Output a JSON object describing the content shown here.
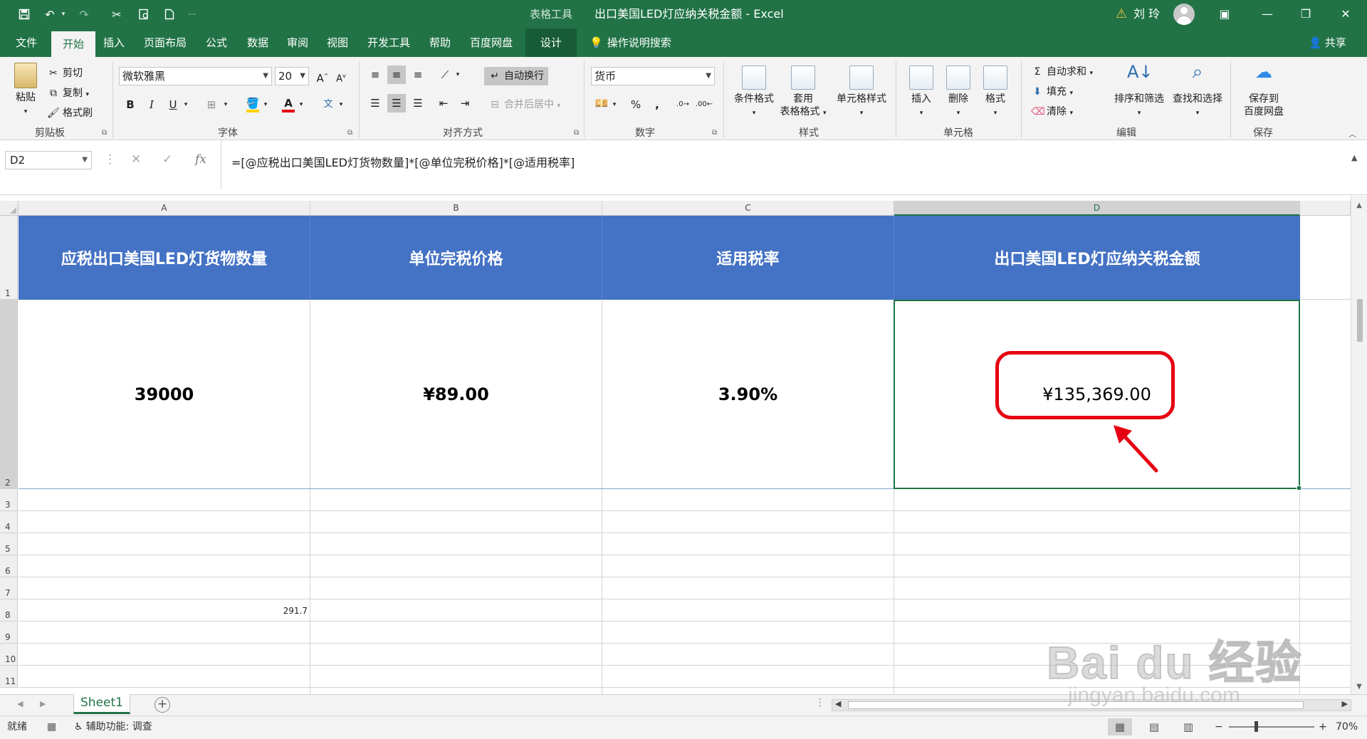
{
  "titlebar": {
    "context_tools": "表格工具",
    "doc_title": "出口美国LED灯应纳关税金额  -  Excel",
    "user": "刘 玲",
    "save_icon": "save-icon",
    "undo_icon": "undo-icon",
    "redo_icon": "redo-icon",
    "cut_icon": "cut-icon",
    "preview_icon": "print-preview-icon",
    "new_icon": "new-document-icon",
    "customize": "customize-quick-access-icon",
    "warning_icon": "warning-icon",
    "min": "—",
    "max": "❐",
    "close": "✕",
    "ribbon_display": "▣"
  },
  "tabs": [
    "文件",
    "开始",
    "插入",
    "页面布局",
    "公式",
    "数据",
    "审阅",
    "视图",
    "开发工具",
    "帮助",
    "百度网盘",
    "设计"
  ],
  "tell_me": "操作说明搜索",
  "share": "共享",
  "ribbon": {
    "clipboard": {
      "paste": "粘贴",
      "cut": "剪切",
      "copy": "复制",
      "format_painter": "格式刷",
      "label": "剪贴板"
    },
    "font": {
      "name": "微软雅黑",
      "size": "20",
      "grow": "A",
      "shrink": "A",
      "bold": "B",
      "italic": "I",
      "underline": "U",
      "phonetic": "文",
      "label": "字体",
      "font_color": "#e60012",
      "fill_color": "#ffd400"
    },
    "alignment": {
      "wrap": "自动换行",
      "merge": "合并后居中",
      "label": "对齐方式"
    },
    "number": {
      "format": "货币",
      "percent": "%",
      "comma": ",",
      "label": "数字"
    },
    "styles": {
      "conditional": "条件格式",
      "as_table_1": "套用",
      "as_table_2": "表格格式",
      "cell_styles": "单元格样式",
      "label": "样式"
    },
    "cells": {
      "insert": "插入",
      "delete": "删除",
      "format": "格式",
      "label": "单元格"
    },
    "editing": {
      "autosum": "自动求和",
      "fill": "填充",
      "clear": "清除",
      "sort": "排序和筛选",
      "find": "查找和选择",
      "label": "编辑"
    },
    "save": {
      "line1": "保存到",
      "line2": "百度网盘",
      "label": "保存"
    }
  },
  "formula_bar": {
    "name_box": "D2",
    "formula": "=[@应税出口美国LED灯货物数量]*[@单位完税价格]*[@适用税率]",
    "fx": "fx"
  },
  "columns": [
    "A",
    "B",
    "C",
    "D"
  ],
  "rows": [
    "1",
    "2",
    "3",
    "4",
    "5",
    "6",
    "7",
    "8",
    "9",
    "10",
    "11"
  ],
  "table": {
    "headers": [
      "应税出口美国LED灯货物数量",
      "单位完税价格",
      "适用税率",
      "出口美国LED灯应纳关税金额"
    ],
    "row2": [
      "39000",
      "¥89.00",
      "3.90%",
      "¥135,369.00"
    ],
    "header_color": "#4472c4"
  },
  "a8_value": "291.7",
  "sheet_tab": "Sheet1",
  "status": {
    "ready": "就绪",
    "accessibility": "辅助功能: 调查",
    "zoom": "70%",
    "zoom_minus": "−",
    "zoom_plus": "+"
  },
  "watermark": {
    "brand": "Bai du 经验",
    "url": "jingyan.baidu.com"
  },
  "accent_color": "#217346",
  "annotation_color": "#e60012"
}
